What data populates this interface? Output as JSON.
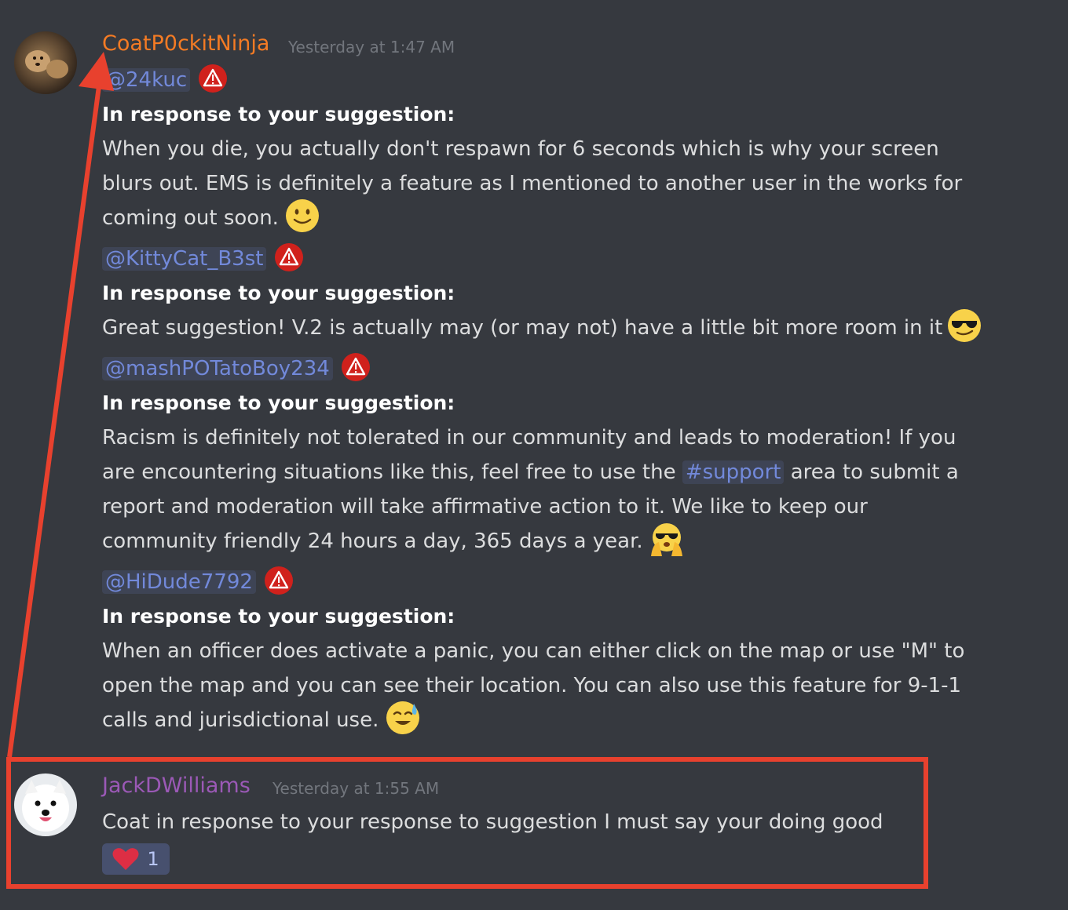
{
  "messages": [
    {
      "author": "CoatP0ckitNinja",
      "author_color": "#f47b24",
      "timestamp": "Yesterday at 1:47 AM",
      "blocks": [
        {
          "mention": "@24kuc",
          "heading": "In response to your suggestion:",
          "lines": [
            "When you die, you actually don't respawn for 6 seconds which is why your screen",
            "blurs out. EMS is definitely a feature as I mentioned to another user in the works for",
            "coming out soon."
          ],
          "emoji": "slightly-smiling-face"
        },
        {
          "mention": "@KittyCat_B3st",
          "heading": "In response to your suggestion:",
          "lines": [
            "Great suggestion! V.2 is actually may (or may not) have a little bit more room in it"
          ],
          "emoji": "smirking-sunglasses-face"
        },
        {
          "mention": "@mashPOTatoBoy234",
          "heading": "In response to your suggestion:",
          "lines": [
            "Racism is definitely not tolerated in our community and leads to moderation! If you",
            "are encountering situations like this, feel free to use the",
            "area to submit a",
            "report and moderation will take affirmative action to it. We like to keep our",
            "community friendly 24 hours a day, 365 days a year."
          ],
          "channel": "#support",
          "emoji": "sunglasses-hands-face"
        },
        {
          "mention": "@HiDude7792",
          "heading": "In response to your suggestion:",
          "lines": [
            "When an officer does activate a panic, you can either click on the map or use \"M\" to",
            "open the map and you can see their location. You can also use this feature for 9-1-1",
            "calls and jurisdictional use."
          ],
          "emoji": "sweat-smile-face"
        }
      ]
    },
    {
      "author": "JackDWilliams",
      "author_color": "#9b59b6",
      "timestamp": "Yesterday at 1:55 AM",
      "text": "Coat in response to your response to suggestion I must say your doing good",
      "reaction": {
        "emoji": "heart-icon",
        "count": "1"
      }
    }
  ],
  "colors": {
    "background": "#36393f",
    "mention": "#7289da",
    "annotation": "#e8412e",
    "warning": "#d0211c"
  }
}
